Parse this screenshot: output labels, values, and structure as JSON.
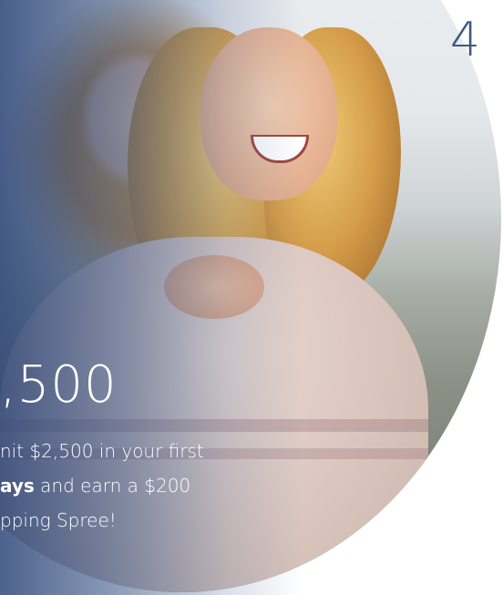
{
  "slide": {
    "page_number": "4",
    "amount_text": ",500",
    "offer_lines": [
      {
        "text": "nit $2,500 in your first"
      },
      {
        "bold": "ays",
        "rest": " and earn a $200"
      },
      {
        "text": "pping Spree!"
      }
    ]
  },
  "colors": {
    "page_number": "#3a5a7c",
    "overlay": "#2d4678",
    "text": "#ffffff"
  }
}
